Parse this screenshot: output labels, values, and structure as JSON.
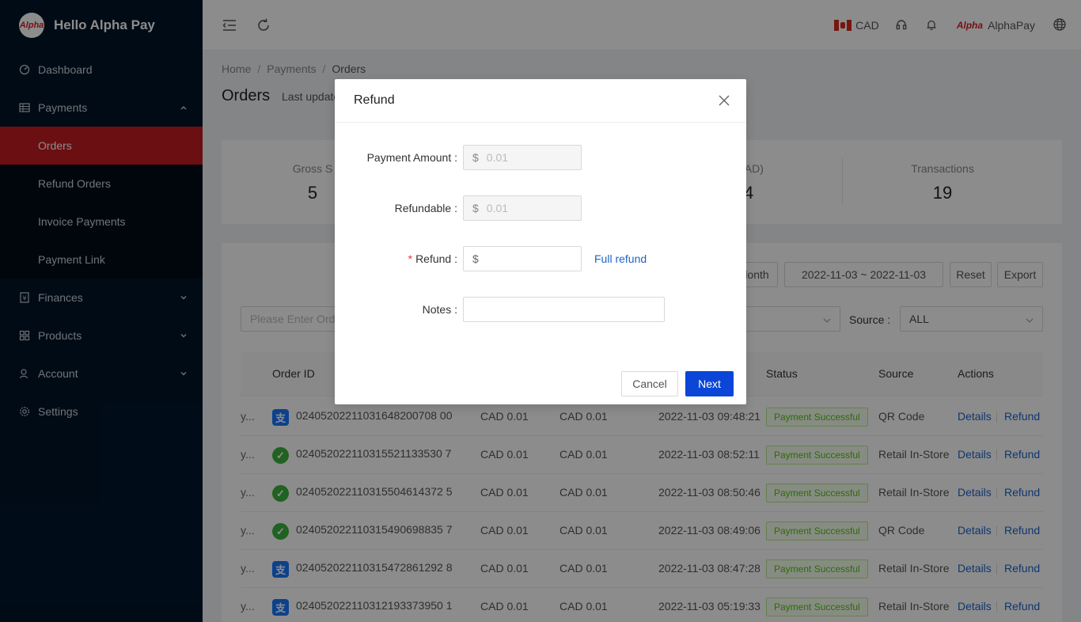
{
  "brand": {
    "logo_text": "Alpha",
    "title": "Hello Alpha Pay"
  },
  "sidebar": {
    "items": [
      {
        "label": "Dashboard",
        "icon": "dashboard-icon"
      },
      {
        "label": "Payments",
        "icon": "table-icon",
        "expanded": true
      },
      {
        "label": "Finances",
        "icon": "finance-icon"
      },
      {
        "label": "Products",
        "icon": "products-icon"
      },
      {
        "label": "Account",
        "icon": "account-icon"
      },
      {
        "label": "Settings",
        "icon": "settings-icon"
      }
    ],
    "payments_sub": [
      {
        "label": "Orders",
        "active": true
      },
      {
        "label": "Refund Orders"
      },
      {
        "label": "Invoice Payments"
      },
      {
        "label": "Payment Link"
      }
    ]
  },
  "header": {
    "currency": "CAD",
    "logo_text": "Alpha",
    "user": "AlphaPay"
  },
  "breadcrumb": {
    "home": "Home",
    "payments": "Payments",
    "orders": "Orders"
  },
  "page": {
    "title": "Orders",
    "last_updated": "Last update"
  },
  "stats": [
    {
      "label": "Gross S",
      "value": "5"
    },
    {
      "label": "s (CAD)",
      "value": "84"
    },
    {
      "label": "Transactions",
      "value": "19"
    }
  ],
  "filters": {
    "month_btn": "lonth",
    "date_range": "2022-11-03  ~  2022-11-03",
    "reset": "Reset",
    "export": "Export",
    "search_placeholder": "Please Enter Orde",
    "source_label": "Source :",
    "source_value": "ALL"
  },
  "table": {
    "headers": {
      "order_id": "Order ID",
      "status": "Status",
      "source": "Source",
      "actions": "Actions"
    },
    "details_label": "Details",
    "refund_label": "Refund",
    "rows": [
      {
        "lead": "y...",
        "method": "alipay",
        "order_id": "02405202211031648200708 00",
        "amount": "CAD 0.01",
        "net": "CAD 0.01",
        "time": "2022-11-03 09:48:21",
        "status": "Payment Successful",
        "source": "QR Code"
      },
      {
        "lead": "y...",
        "method": "wechat",
        "order_id": "024052022110315521133530 7",
        "amount": "CAD 0.01",
        "net": "CAD 0.01",
        "time": "2022-11-03 08:52:11",
        "status": "Payment Successful",
        "source": "Retail In-Store"
      },
      {
        "lead": "y...",
        "method": "wechat",
        "order_id": "024052022110315504614372 5",
        "amount": "CAD 0.01",
        "net": "CAD 0.01",
        "time": "2022-11-03 08:50:46",
        "status": "Payment Successful",
        "source": "Retail In-Store"
      },
      {
        "lead": "y...",
        "method": "wechat",
        "order_id": "024052022110315490698835 7",
        "amount": "CAD 0.01",
        "net": "CAD 0.01",
        "time": "2022-11-03 08:49:06",
        "status": "Payment Successful",
        "source": "QR Code"
      },
      {
        "lead": "y...",
        "method": "alipay",
        "order_id": "024052022110315472861292 8",
        "amount": "CAD 0.01",
        "net": "CAD 0.01",
        "time": "2022-11-03 08:47:28",
        "status": "Payment Successful",
        "source": "Retail In-Store"
      },
      {
        "lead": "y...",
        "method": "alipay",
        "order_id": "024052022110312193373950 1",
        "amount": "CAD 0.01",
        "net": "CAD 0.01",
        "time": "2022-11-03 05:19:33",
        "status": "Payment Successful",
        "source": "Retail In-Store"
      }
    ]
  },
  "modal": {
    "title": "Refund",
    "payment_amount_label": "Payment Amount :",
    "payment_amount_value": "0.01",
    "refundable_label": "Refundable :",
    "refundable_value": "0.01",
    "refund_label": "Refund :",
    "refund_value": "",
    "currency_prefix": "$",
    "full_refund": "Full refund",
    "notes_label": "Notes :",
    "notes_value": "",
    "cancel": "Cancel",
    "next": "Next"
  }
}
